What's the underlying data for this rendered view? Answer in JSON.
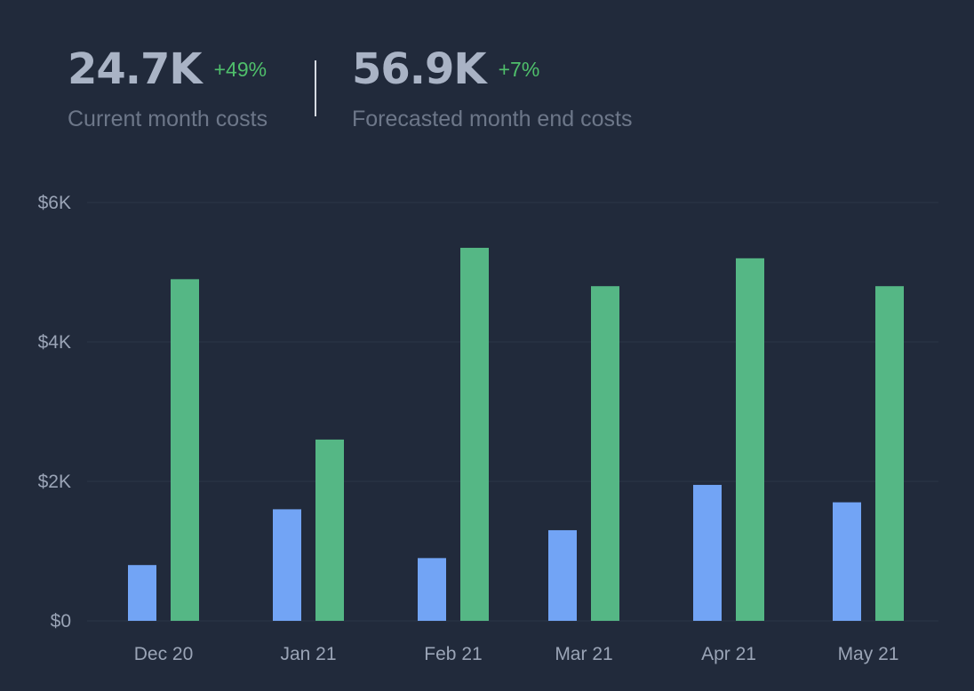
{
  "kpis": {
    "current": {
      "value": "24.7K",
      "change": "+49%",
      "label": "Current month costs"
    },
    "forecast": {
      "value": "56.9K",
      "change": "+7%",
      "label": "Forecasted month end costs"
    }
  },
  "colors": {
    "background": "#212a3b",
    "series_blue": "#72a4f5",
    "series_green": "#55b785",
    "positive_change": "#4fbf6b",
    "gridline": "#2b3547"
  },
  "chart_data": {
    "type": "bar",
    "categories": [
      "Dec 20",
      "Jan 21",
      "Feb 21",
      "Mar 21",
      "Apr 21",
      "May 21"
    ],
    "series": [
      {
        "values": [
          800,
          1600,
          900,
          1300,
          1950,
          1700
        ]
      },
      {
        "values": [
          4900,
          2600,
          5350,
          4800,
          5200,
          4800
        ]
      }
    ],
    "yticks": [
      0,
      2000,
      4000,
      6000
    ],
    "ytick_labels": [
      "$0",
      "$2K",
      "$4K",
      "$6K"
    ],
    "ylim": [
      0,
      6000
    ],
    "grid": true,
    "legend": "none"
  }
}
